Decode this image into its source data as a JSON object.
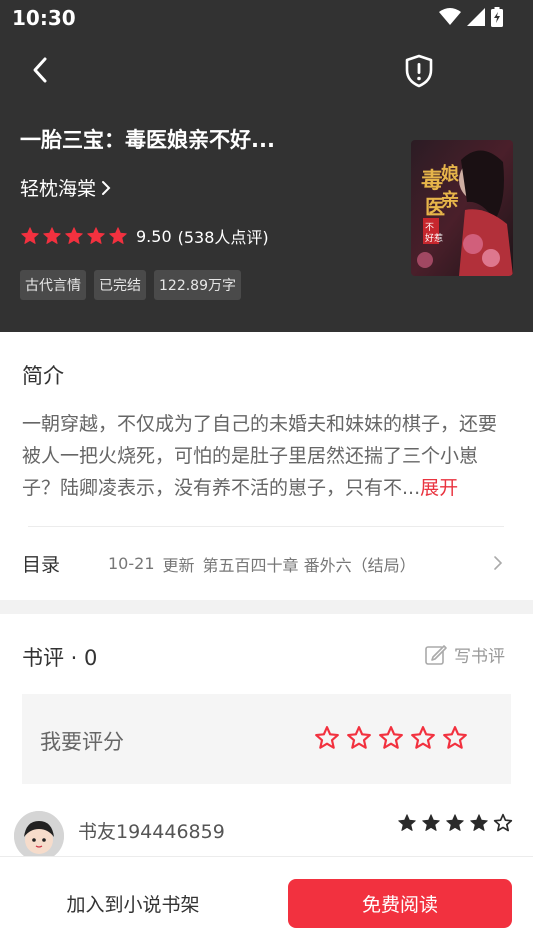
{
  "status_bar": {
    "time": "10:30"
  },
  "book": {
    "title": "一胎三宝：毒医娘亲不好...",
    "author": "轻枕海棠",
    "rating": "9.50",
    "rating_count": "(538人点评)",
    "rating_stars": 5,
    "tags": [
      "古代言情",
      "已完结",
      "122.89万字"
    ],
    "cover_text": "毒医娘亲不好惹"
  },
  "intro": {
    "title": "简介",
    "text": "一朝穿越，不仅成为了自己的未婚夫和妹妹的棋子，还要被人一把火烧死，可怕的是肚子里居然还揣了三个小崽子？陆卿凌表示，没有养不活的崽子，只有不...",
    "expand_label": "展开"
  },
  "toc": {
    "label": "目录",
    "date": "10-21",
    "update": "更新",
    "chapter": "第五百四十章 番外六（结局）"
  },
  "reviews": {
    "title": "书评 · 0",
    "write_label": "写书评",
    "rate_label": "我要评分",
    "rate_star_count": 5,
    "reviewer_name": "书友194446859",
    "reviewer_rating": 4.5
  },
  "bottom": {
    "add_shelf_label": "加入到小说书架",
    "read_label": "免费阅读"
  },
  "colors": {
    "accent": "#f2313f",
    "header_bg": "#323232"
  }
}
